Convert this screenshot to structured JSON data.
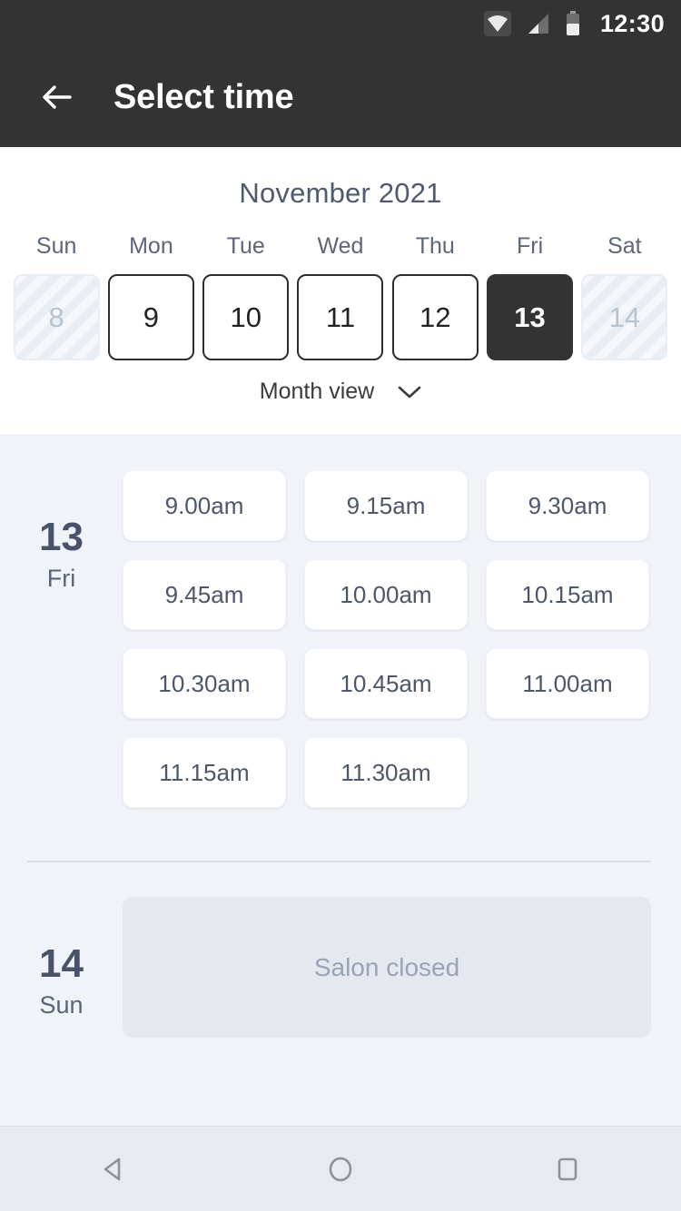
{
  "status_bar": {
    "time": "12:30",
    "icons": [
      "wifi-icon",
      "signal-icon",
      "battery-icon"
    ]
  },
  "app_bar": {
    "back_icon": "arrow-left-icon",
    "title": "Select time"
  },
  "calendar": {
    "month_title": "November 2021",
    "weekdays": [
      "Sun",
      "Mon",
      "Tue",
      "Wed",
      "Thu",
      "Fri",
      "Sat"
    ],
    "days": [
      {
        "label": "8",
        "state": "disabled"
      },
      {
        "label": "9",
        "state": "normal"
      },
      {
        "label": "10",
        "state": "normal"
      },
      {
        "label": "11",
        "state": "normal"
      },
      {
        "label": "12",
        "state": "normal"
      },
      {
        "label": "13",
        "state": "selected"
      },
      {
        "label": "14",
        "state": "disabled"
      }
    ],
    "view_toggle_label": "Month view",
    "view_toggle_icon": "chevron-down-icon"
  },
  "schedule": {
    "days": [
      {
        "date_number": "13",
        "day_of_week": "Fri",
        "slots": [
          "9.00am",
          "9.15am",
          "9.30am",
          "9.45am",
          "10.00am",
          "10.15am",
          "10.30am",
          "10.45am",
          "11.00am",
          "11.15am",
          "11.30am"
        ]
      },
      {
        "date_number": "14",
        "day_of_week": "Sun",
        "closed_label": "Salon closed"
      }
    ]
  },
  "nav_bar": {
    "back_label": "back-triangle-icon",
    "home_label": "home-circle-icon",
    "recents_label": "recents-square-icon"
  },
  "colors": {
    "app_bar_bg": "#333333",
    "page_bg": "#f0f3f7",
    "selected_day_bg": "#333333",
    "slot_text": "#4d5769",
    "muted_text": "#9aa3b4"
  }
}
